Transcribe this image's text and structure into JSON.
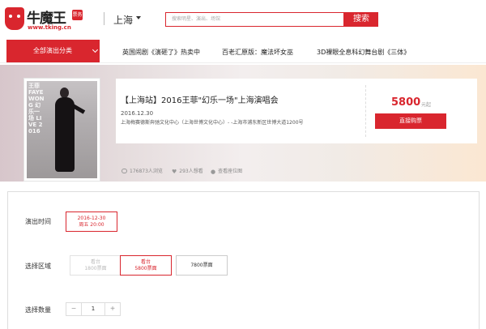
{
  "header": {
    "logo_text": "牛魔王",
    "logo_tag": "票务",
    "logo_url": "www.tking.cn",
    "city": "上海",
    "search_placeholder": "搜索明星、演出、场馆",
    "search_button": "搜索"
  },
  "nav": {
    "all_categories": "全部演出分类",
    "links": [
      "英国闹剧《演砸了》热卖中",
      "百老汇原版：魔法坏女巫",
      "3D裸眼全息科幻舞台剧《三体》"
    ]
  },
  "show": {
    "poster_text": "王菲 FAYE WONG 幻乐一场 LIVE 2016",
    "title": "【上海站】2016王菲\"幻乐一场\"上海演唱会",
    "date": "2016.12.30",
    "venue": "上海梅赛德斯奔驰文化中心（上海世博文化中心）- -上海市浦东新区世博大道1200号",
    "price": "5800",
    "price_unit": "元起",
    "buy_button": "直接购票"
  },
  "stats": {
    "views": "176873人浏览",
    "wants": "293人想看",
    "map": "查看座位图"
  },
  "booking": {
    "time_label": "演出时间",
    "time_option": {
      "date": "2016-12-30",
      "sub": "周五 20:00"
    },
    "area_label": "选择区域",
    "area_options": [
      {
        "line1": "看台",
        "line2": "1800票面",
        "state": "disabled"
      },
      {
        "line1": "看台",
        "line2": "5800票面",
        "state": "selected"
      },
      {
        "line1": "7800票面",
        "line2": "",
        "state": "normal"
      }
    ],
    "qty_label": "选择数量",
    "qty_minus": "−",
    "qty_value": "1",
    "qty_plus": "+"
  },
  "colors": {
    "accent": "#d9262e"
  }
}
